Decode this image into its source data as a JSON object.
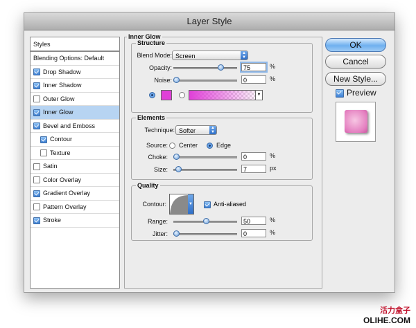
{
  "window": {
    "title": "Layer Style"
  },
  "styles_panel": {
    "header": "Styles",
    "items": [
      {
        "label": "Blending Options: Default",
        "checkbox": null,
        "selected": false,
        "indent": false
      },
      {
        "label": "Drop Shadow",
        "checkbox": true,
        "selected": false,
        "indent": false
      },
      {
        "label": "Inner Shadow",
        "checkbox": true,
        "selected": false,
        "indent": false
      },
      {
        "label": "Outer Glow",
        "checkbox": false,
        "selected": false,
        "indent": false
      },
      {
        "label": "Inner Glow",
        "checkbox": true,
        "selected": true,
        "indent": false
      },
      {
        "label": "Bevel and Emboss",
        "checkbox": true,
        "selected": false,
        "indent": false
      },
      {
        "label": "Contour",
        "checkbox": true,
        "selected": false,
        "indent": true
      },
      {
        "label": "Texture",
        "checkbox": false,
        "selected": false,
        "indent": true
      },
      {
        "label": "Satin",
        "checkbox": false,
        "selected": false,
        "indent": false
      },
      {
        "label": "Color Overlay",
        "checkbox": false,
        "selected": false,
        "indent": false
      },
      {
        "label": "Gradient Overlay",
        "checkbox": true,
        "selected": false,
        "indent": false
      },
      {
        "label": "Pattern Overlay",
        "checkbox": false,
        "selected": false,
        "indent": false
      },
      {
        "label": "Stroke",
        "checkbox": true,
        "selected": false,
        "indent": false
      }
    ]
  },
  "inner_glow": {
    "title": "Inner Glow",
    "structure": {
      "title": "Structure",
      "blend_mode_label": "Blend Mode:",
      "blend_mode_value": "Screen",
      "opacity_label": "Opacity:",
      "opacity_value": "75",
      "opacity_fraction": 0.75,
      "opacity_unit": "%",
      "noise_label": "Noise:",
      "noise_value": "0",
      "noise_fraction": 0.0,
      "noise_unit": "%",
      "color_radio_selected": true,
      "glow_color": "#e040d8"
    },
    "elements": {
      "title": "Elements",
      "technique_label": "Technique:",
      "technique_value": "Softer",
      "source_label": "Source:",
      "source_center": "Center",
      "source_edge": "Edge",
      "choke_label": "Choke:",
      "choke_value": "0",
      "choke_fraction": 0.0,
      "choke_unit": "%",
      "size_label": "Size:",
      "size_value": "7",
      "size_fraction": 0.03,
      "size_unit": "px"
    },
    "quality": {
      "title": "Quality",
      "contour_label": "Contour:",
      "anti_aliased_label": "Anti-aliased",
      "range_label": "Range:",
      "range_value": "50",
      "range_fraction": 0.5,
      "range_unit": "%",
      "jitter_label": "Jitter:",
      "jitter_value": "0",
      "jitter_fraction": 0.0,
      "jitter_unit": "%"
    }
  },
  "buttons": {
    "ok": "OK",
    "cancel": "Cancel",
    "new_style": "New Style...",
    "preview": "Preview"
  },
  "watermark": {
    "line1": "活力盒子",
    "line2": "OLIHE.COM"
  },
  "colors": {
    "accent": "#3d7fd3",
    "selection": "#b7d4f2",
    "glow": "#e040d8"
  }
}
